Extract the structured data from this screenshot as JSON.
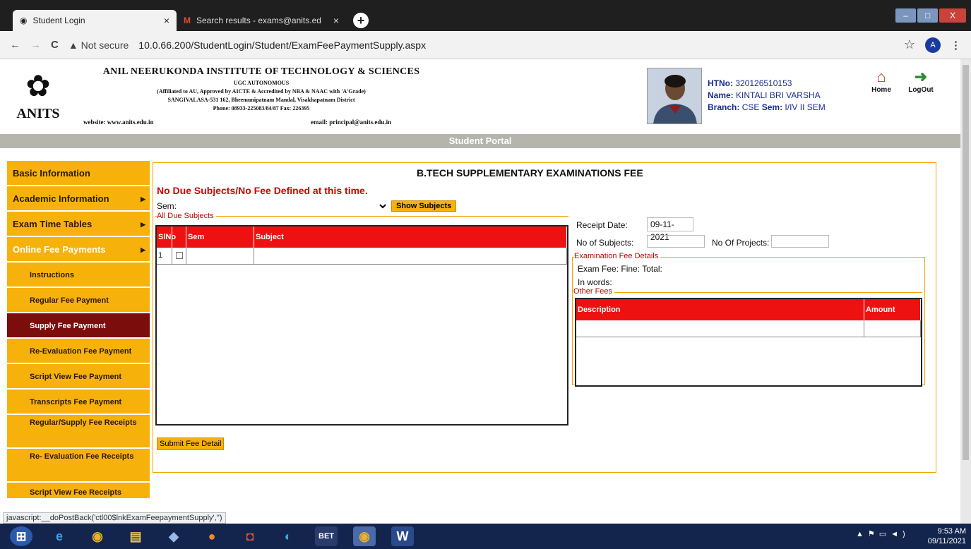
{
  "browser": {
    "tabs": [
      {
        "title": "Student Login",
        "close": "×"
      },
      {
        "title": "Search results - exams@anits.ed",
        "close": "×"
      }
    ],
    "new_tab": "+",
    "nav": {
      "back": "←",
      "forward": "→",
      "reload": "C"
    },
    "security": "▲ Not secure",
    "url": "10.0.66.200/StudentLogin/Student/ExamFeePaymentSupply.aspx",
    "star": "☆",
    "profile_initial": "A",
    "menu": "⋮",
    "window_buttons": [
      "–",
      "□",
      "X"
    ]
  },
  "header": {
    "logo_text": "ANITS",
    "institution_name": "ANIL NEERUKONDA INSTITUTE OF TECHNOLOGY & SCIENCES",
    "autonomous": "UGC AUTONOMOUS",
    "affiliation": "(Affiliated to AU, Approved by AICTE & Accredited by NBA & NAAC with 'A'Grade)",
    "address": "SANGIVALASA-531 162, Bheemunipatnam Mandal, Visakhapatnam District",
    "phone": "Phone: 08933-225083/84/87 Fax: 226395",
    "website": "website: www.anits.edu.in",
    "email": "email: principal@anits.edu.in",
    "student": {
      "htno_label": "HTNo:",
      "htno": "320126510153",
      "name_label": "Name:",
      "name": "KINTALI BRI VARSHA",
      "branch_label": "Branch:",
      "branch": "CSE",
      "sem_label": "Sem:",
      "sem": "I/IV II SEM"
    },
    "home_label": "Home",
    "logout_label": "LogOut"
  },
  "portal_title": "Student Portal",
  "sidebar": {
    "main": [
      {
        "label": "Basic Information",
        "arrow": ""
      },
      {
        "label": "Academic Information",
        "arrow": "▶"
      },
      {
        "label": "Exam Time Tables",
        "arrow": "▶"
      },
      {
        "label": "Online Fee Payments",
        "arrow": "▶"
      }
    ],
    "sub": [
      "Instructions",
      "Regular Fee Payment",
      "Supply Fee Payment",
      "Re-Evaluation Fee Payment",
      "Script View Fee Payment",
      "Transcripts Fee Payment",
      "Regular/Supply Fee Receipts",
      "Re- Evaluation Fee Receipts",
      "Script View Fee Receipts"
    ]
  },
  "main": {
    "title": "B.TECH SUPPLEMENTARY EXAMINATIONS FEE",
    "notice": "No Due Subjects/No Fee Defined at this time.",
    "sem_label": "Sem:",
    "show_button": "Show Subjects",
    "due_legend": "All Due Subjects",
    "due_columns": [
      "SlNo",
      "",
      "Sem",
      "Subject"
    ],
    "due_rows": [
      [
        "1",
        "",
        "",
        ""
      ]
    ],
    "receipt_label": "Receipt Date:",
    "receipt_date": "09-11-2021",
    "no_subjects_label": "No of Subjects:",
    "no_projects_label": "No Of Projects:",
    "exam_legend": "Examination Fee Details",
    "exam_fee_label": "Exam Fee:",
    "fine_label": "Fine:",
    "total_label": "Total:",
    "in_words_label": "In words:",
    "other_legend": "Other Fees",
    "other_columns": [
      "Description",
      "Amount"
    ],
    "submit_button": "Submit Fee Detail"
  },
  "status_bar": "javascript:__doPostBack('ctl00$lnkExamFeepaymentSupply','')",
  "taskbar": {
    "time": "9:53 AM",
    "date": "09/11/2021"
  }
}
